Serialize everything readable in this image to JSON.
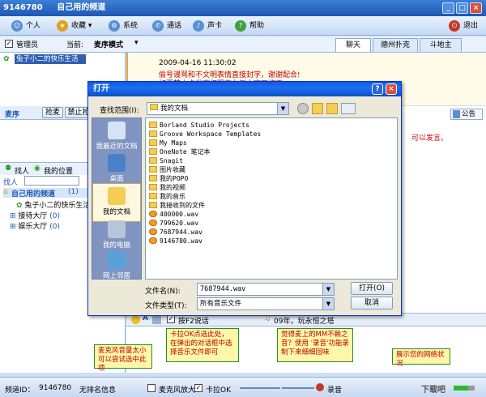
{
  "window": {
    "id": "9146780",
    "title": "自己用的频道",
    "minimize": "_",
    "maximize": "□",
    "close": "×",
    "exit_label": "退出"
  },
  "menu": [
    {
      "label": "个人",
      "icon": "person-icon"
    },
    {
      "label": "收藏",
      "icon": "star-icon"
    },
    {
      "label": "系统",
      "icon": "gear-icon"
    },
    {
      "label": "通话",
      "icon": "phone-icon"
    },
    {
      "label": "声卡",
      "icon": "soundcard-icon"
    },
    {
      "label": "帮助",
      "icon": "help-icon"
    }
  ],
  "subbar": {
    "admin_checkbox": "管理员",
    "current_label": "当前:",
    "mode_label": "麦序模式",
    "tabs": [
      "聊天",
      "德州扑克",
      "斗地主"
    ]
  },
  "left_top": {
    "user_entry": "兔子小二的快乐生活"
  },
  "chat": {
    "timestamp": "2009-04-16 11:30:02",
    "line1": "偷号谩骂和不文明表情直接封字，谢谢配合!",
    "line2": "如要禁止卡发言权限在左侧小窗口修正",
    "side_note": "可以发言。"
  },
  "mic": {
    "label": "麦序",
    "grab_button": "抢麦",
    "ban_button": "禁止抢"
  },
  "notice_label": "公告",
  "search": {
    "find_label": "找人",
    "my_position": "我的位置",
    "find_input_label": "找人"
  },
  "tree": {
    "root": "自己用的频道",
    "root_count": "(1)",
    "user": "兔子小二的快乐生活",
    "hall1": "接待大厅",
    "hall1_count": "(0)",
    "hall2": "娱乐大厅",
    "hall2_count": "(0)"
  },
  "bottom_toolbar": {
    "ptt_label": "按F2说话",
    "song_label": "09年，玩永恒之塔"
  },
  "status": {
    "channel_id_label": "频道ID：",
    "channel_id": "9146780",
    "no_sign": "无排名信息",
    "mic_amplify": "麦克风放大",
    "karaoke": "卡拉OK",
    "record": "录音",
    "watermark": "下载吧"
  },
  "callouts": {
    "c1": "麦克风音量太小可以尝试选中此项",
    "c2": "卡拉OK点选此处，在弹出的对话框中选择音乐文件即可",
    "c3": "觉得麦上的MM不赖之音？使用 '录音'功能录制下来细细回味",
    "c4": "展示您的网络状况"
  },
  "dialog": {
    "title": "打开",
    "help": "?",
    "close": "×",
    "lookin_label": "查找范围(I):",
    "lookin_value": "我的文档",
    "places": [
      {
        "label": "我最近的文档",
        "icon": "recent-docs-icon"
      },
      {
        "label": "桌面",
        "icon": "desktop-icon"
      },
      {
        "label": "我的文档",
        "icon": "my-documents-icon"
      },
      {
        "label": "我的电脑",
        "icon": "my-computer-icon"
      },
      {
        "label": "网上邻居",
        "icon": "network-icon"
      }
    ],
    "files": [
      {
        "name": "Borland Studio Projects",
        "kind": "folder"
      },
      {
        "name": "Groove Workspace Templates",
        "kind": "folder"
      },
      {
        "name": "My Maps",
        "kind": "folder"
      },
      {
        "name": "OneNote 笔记本",
        "kind": "folder"
      },
      {
        "name": "Snagit",
        "kind": "folder"
      },
      {
        "name": "图片收藏",
        "kind": "folder"
      },
      {
        "name": "我的POPO",
        "kind": "folder"
      },
      {
        "name": "我的视频",
        "kind": "folder"
      },
      {
        "name": "我的音乐",
        "kind": "folder"
      },
      {
        "name": "我接收到的文件",
        "kind": "folder"
      },
      {
        "name": "400000.wav",
        "kind": "audio"
      },
      {
        "name": "799620.wav",
        "kind": "audio"
      },
      {
        "name": "7687944.wav",
        "kind": "audio"
      },
      {
        "name": "9146780.wav",
        "kind": "audio"
      }
    ],
    "filename_label": "文件名(N):",
    "filename_value": "7687944.wav",
    "filetype_label": "文件类型(T):",
    "filetype_value": "所有音乐文件",
    "open_button": "打开(O)",
    "cancel_button": "取消"
  }
}
